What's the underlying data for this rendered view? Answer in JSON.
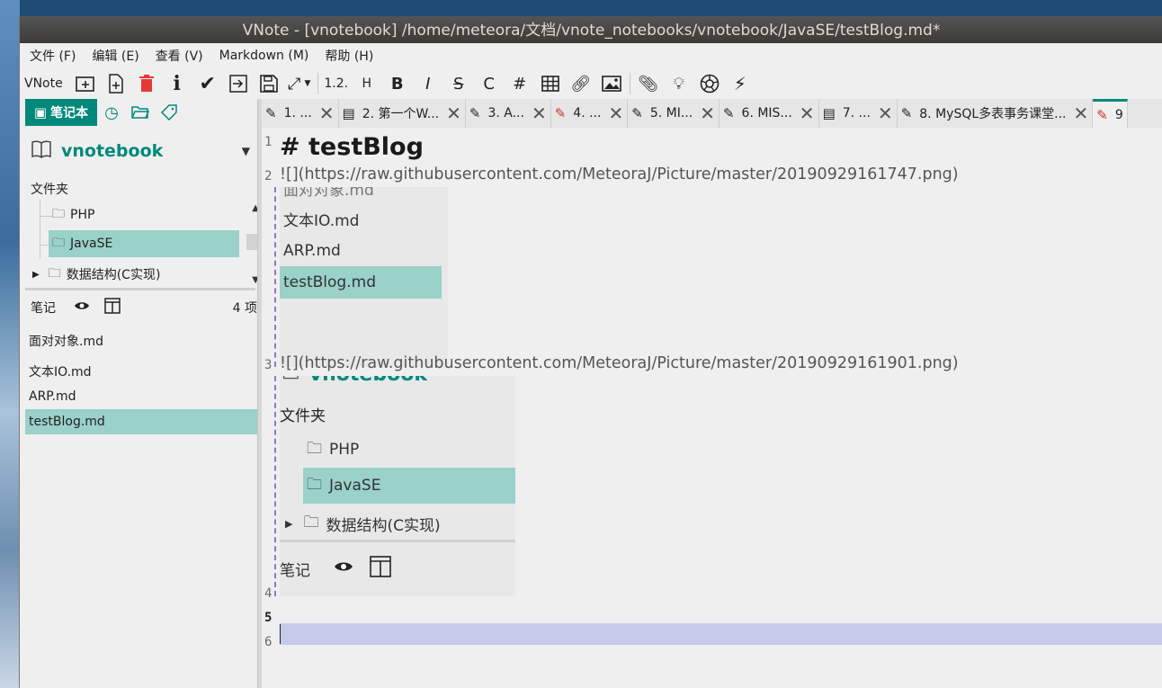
{
  "window": {
    "title": "VNote - [vnotebook] /home/meteora/文档/vnote_notebooks/vnotebook/JavaSE/testBlog.md*"
  },
  "menu": {
    "file": "文件 (F)",
    "edit": "编辑 (E)",
    "view": "查看 (V)",
    "markdown": "Markdown (M)",
    "help": "帮助 (H)"
  },
  "toolbar": {
    "app_label": "VNote",
    "ordered_list": "1.2.",
    "heading": "H",
    "bold": "B",
    "italic": "I",
    "strike": "S",
    "code": "C",
    "hash": "#"
  },
  "left_panel": {
    "tab_notebook": "笔记本",
    "notebook_name": "vnotebook",
    "folders_label": "文件夹",
    "folders": [
      {
        "label": "PHP"
      },
      {
        "label": "JavaSE"
      },
      {
        "label": "数据结构(C实现)"
      }
    ],
    "notes_label": "笔记",
    "notes_count": "4 项",
    "notes": [
      {
        "label": "面对对象.md"
      },
      {
        "label": "文本IO.md"
      },
      {
        "label": "ARP.md"
      },
      {
        "label": "testBlog.md"
      }
    ]
  },
  "tabs": [
    {
      "label": "1. ...",
      "icon": "pencil-icon"
    },
    {
      "label": "2. 第一个W...",
      "icon": "document-icon"
    },
    {
      "label": "3. A...",
      "icon": "pencil-icon"
    },
    {
      "label": "4. ...",
      "icon": "pencil-red-icon"
    },
    {
      "label": "5. MI...",
      "icon": "pencil-icon"
    },
    {
      "label": "6. MIS...",
      "icon": "pencil-icon"
    },
    {
      "label": "7. ...",
      "icon": "document-icon"
    },
    {
      "label": "8. MySQL多表事务课堂...",
      "icon": "pencil-icon"
    },
    {
      "label": "9",
      "icon": "pencil-red-icon"
    }
  ],
  "editor": {
    "line_numbers": [
      "1",
      "2",
      "3",
      "4",
      "5",
      "6"
    ],
    "heading": "# testBlog",
    "line2": "![](https://raw.githubusercontent.com/MeteoraJ/Picture/master/20190929161747.png)",
    "line3": "![](https://raw.githubusercontent.com/MeteoraJ/Picture/master/20190929161901.png)",
    "preview1": {
      "partial_top": "面对对象.md",
      "items": [
        "文本IO.md",
        "ARP.md",
        "testBlog.md"
      ]
    },
    "preview2": {
      "partial_top": "vnotebook",
      "folders_label": "文件夹",
      "folders": [
        "PHP",
        "JavaSE",
        "数据结构(C实现)"
      ],
      "notes_label": "笔记"
    }
  },
  "colors": {
    "accent": "#00897b",
    "selection": "#9ad1c9",
    "cursor_line": "#c5cae9"
  }
}
